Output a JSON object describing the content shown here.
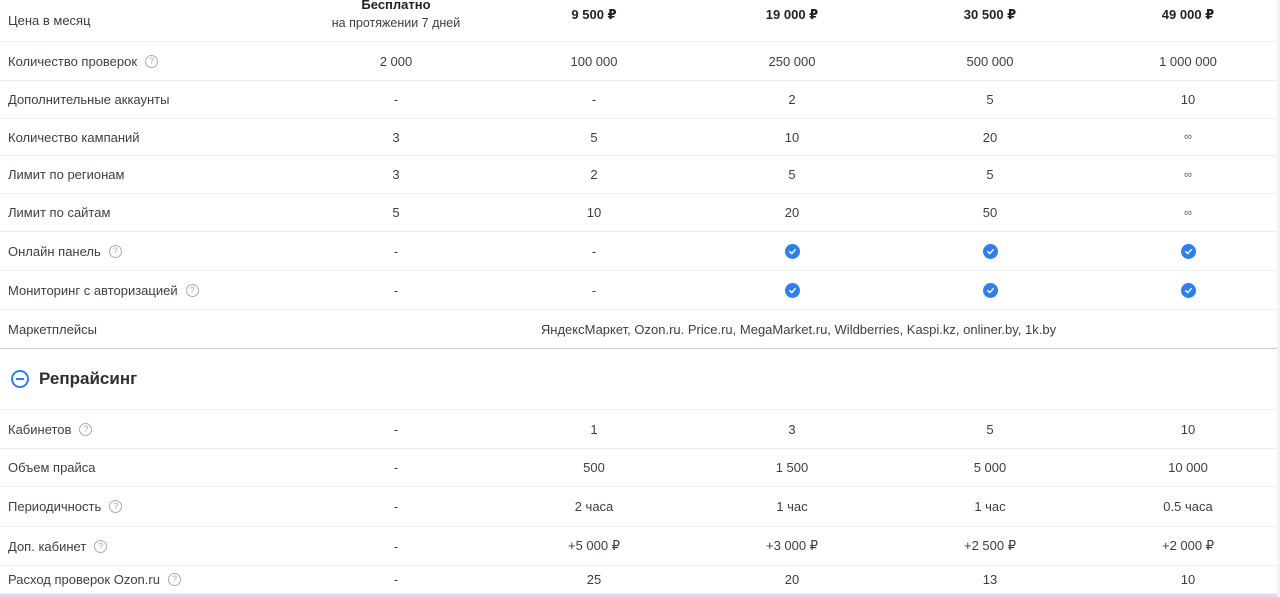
{
  "plans_table": {
    "price_row": {
      "label": "Цена в месяц",
      "free_title": "Бесплатно",
      "free_subtitle": "на протяжении 7 дней",
      "prices": [
        "9 500 ₽",
        "19 000 ₽",
        "30 500 ₽",
        "49 000 ₽"
      ]
    },
    "rows": [
      {
        "label": "Количество проверок",
        "help": true,
        "values": [
          "2 000",
          "100 000",
          "250 000",
          "500 000",
          "1 000 000"
        ]
      },
      {
        "label": "Дополнительные аккаунты",
        "help": false,
        "values": [
          "-",
          "-",
          "2",
          "5",
          "10"
        ]
      },
      {
        "label": "Количество кампаний",
        "help": false,
        "values": [
          "3",
          "5",
          "10",
          "20",
          "∞"
        ]
      },
      {
        "label": "Лимит по регионам",
        "help": false,
        "values": [
          "3",
          "2",
          "5",
          "5",
          "∞"
        ]
      },
      {
        "label": "Лимит по сайтам",
        "help": false,
        "values": [
          "5",
          "10",
          "20",
          "50",
          "∞"
        ]
      },
      {
        "label": "Онлайн панель",
        "help": true,
        "values": [
          "-",
          "-",
          "check",
          "check",
          "check"
        ]
      },
      {
        "label": "Мониторинг с авторизацией",
        "help": true,
        "values": [
          "-",
          "-",
          "check",
          "check",
          "check"
        ]
      }
    ],
    "marketplaces": {
      "label": "Маркетплейсы",
      "value": "ЯндексМаркет, Ozon.ru. Price.ru, MegaMarket.ru, Wildberries, Kaspi.kz, onliner.by, 1k.by"
    }
  },
  "repricing": {
    "title": "Репрайсинг",
    "toggle_icon": "minus-circle-icon",
    "rows": [
      {
        "label": "Кабинетов",
        "help": true,
        "values": [
          "-",
          "1",
          "3",
          "5",
          "10"
        ]
      },
      {
        "label": "Объем прайса",
        "help": false,
        "values": [
          "-",
          "500",
          "1 500",
          "5 000",
          "10 000"
        ]
      },
      {
        "label": "Периодичность",
        "help": true,
        "values": [
          "-",
          "2 часа",
          "1 час",
          "1 час",
          "0.5 часа"
        ]
      },
      {
        "label": "Доп. кабинет",
        "help": true,
        "values": [
          "-",
          "+5 000 ₽",
          "+3 000 ₽",
          "+2 500 ₽",
          "+2 000 ₽"
        ]
      },
      {
        "label": "Расход проверок Ozon.ru",
        "help": true,
        "values": [
          "-",
          "25",
          "20",
          "13",
          "10"
        ]
      }
    ]
  },
  "help_glyph": "?",
  "colors": {
    "accent": "#2f80ed",
    "text": "#2b2f36",
    "divider": "#eceef1"
  }
}
